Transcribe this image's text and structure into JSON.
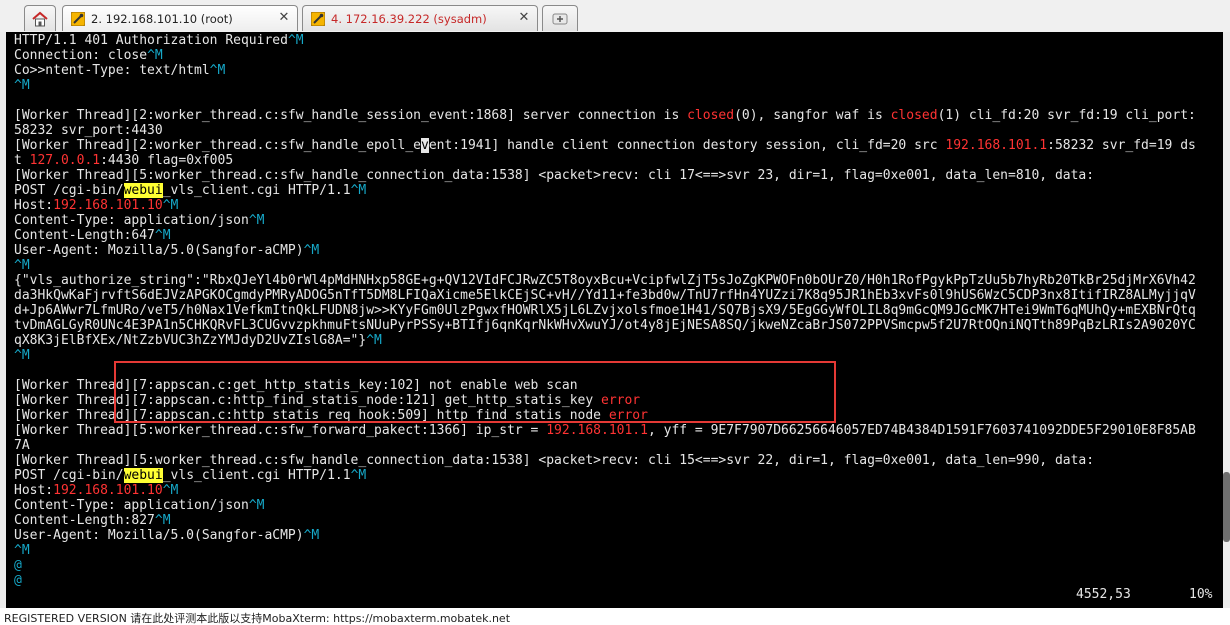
{
  "tabs": [
    {
      "label": "2. 192.168.101.10 (root)",
      "active": true
    },
    {
      "label": "4. 172.16.39.222 (sysadm)",
      "active": false
    }
  ],
  "colors": {
    "background": "#000000",
    "text": "#e6e6e6",
    "control_char": "#16a8c8",
    "highlight_red": "#ff3333",
    "search_hit": "#ffff33",
    "annotation_box": "#e53935"
  },
  "terminal": {
    "lines": [
      [
        {
          "t": "HTTP/1.1 401 Authorization Required"
        },
        {
          "t": "^M",
          "s": "c"
        }
      ],
      [
        {
          "t": "Connection: close"
        },
        {
          "t": "^M",
          "s": "c"
        }
      ],
      [
        {
          "t": "Co>>ntent-Type: text/html"
        },
        {
          "t": "^M",
          "s": "c"
        }
      ],
      [
        {
          "t": "^M",
          "s": "c"
        }
      ],
      [
        {
          "t": ""
        }
      ],
      [
        {
          "t": "[Worker Thread][2:worker_thread.c:sfw_handle_session_event:1868] server connection is "
        },
        {
          "t": "closed",
          "s": "r"
        },
        {
          "t": "(0), sangfor waf is "
        },
        {
          "t": "closed",
          "s": "r"
        },
        {
          "t": "(1) cli_fd:20 svr_fd:19 cli_port:"
        }
      ],
      [
        {
          "t": "58232 svr_port:4430"
        }
      ],
      [
        {
          "t": "[Worker Thread][2:worker_thread.c:sfw_handle_epoll_e"
        },
        {
          "t": "v",
          "s": "cur"
        },
        {
          "t": "ent:1941] handle client connection destory session, cli_fd=20 src "
        },
        {
          "t": "192.168.101.1",
          "s": "r"
        },
        {
          "t": ":58232 svr_fd=19 ds"
        }
      ],
      [
        {
          "t": "t "
        },
        {
          "t": "127.0.0.1",
          "s": "r"
        },
        {
          "t": ":4430 flag=0xf005"
        }
      ],
      [
        {
          "t": "[Worker Thread][5:worker_thread.c:sfw_handle_connection_data:1538] <packet>recv: cli 17<==>svr 23, dir=1, flag=0xe001, data_len=810, data:"
        }
      ],
      [
        {
          "t": "POST /cgi-bin/"
        },
        {
          "t": "webui",
          "s": "hl"
        },
        {
          "t": "_vls_client.cgi HTTP/1.1"
        },
        {
          "t": "^M",
          "s": "c"
        }
      ],
      [
        {
          "t": "Host:"
        },
        {
          "t": "192.168.101.10",
          "s": "r"
        },
        {
          "t": "^M",
          "s": "c"
        }
      ],
      [
        {
          "t": "Content-Type: application/json"
        },
        {
          "t": "^M",
          "s": "c"
        }
      ],
      [
        {
          "t": "Content-Length:647"
        },
        {
          "t": "^M",
          "s": "c"
        }
      ],
      [
        {
          "t": "User-Agent: Mozilla/5.0(Sangfor-aCMP)"
        },
        {
          "t": "^M",
          "s": "c"
        }
      ],
      [
        {
          "t": "^M",
          "s": "c"
        }
      ],
      [
        {
          "t": "{\"vls_authorize_string\":\"RbxQJeYl4b0rWl4pMdHNHxp58GE+g+QV12VIdFCJRwZC5T8oyxBcu+VcipfwlZjT5sJoZgKPWOFn0bOUrZ0/H0h1RofPgykPpTzUu5b7hyRb20TkBr25djMrX6Vh42"
        }
      ],
      [
        {
          "t": "da3HkQwKaFjrvftS6dEJVzAPGKOCgmdyPMRyADOG5nTfT5DM8LFIQaXicme5ElkCEjSC+vH//Yd11+fe3bd0w/TnU7rfHn4YUZzi7K8q95JR1hEb3xvFs0l9hUS6WzC5CDP3nx8ItifIRZ8ALMyjjqV"
        }
      ],
      [
        {
          "t": "d+Jp6AWwr7LfmURo/veT5/h0Nax1VefkmItnQkLFUDN8jw>>KYyFGm0UlzPgwxfHOWRlX5jL6LZvjxolsfmoe1H41/SQ7BjsX9/5EgGGyWfOLIL8q9mGcQM9JGcMK7HTei9WmT6qMUhQy+mEXBNrQtq"
        }
      ],
      [
        {
          "t": "tvDmAGLGyR0UNc4E3PA1n5CHKQRvFL3CUGvvzpkhmuFtsNUuPyrPSSy+BTIfj6qnKqrNkWHvXwuYJ/ot4y8jEjNESA8SQ/jkweNZcaBrJS072PPVSmcpw5f2U7RtOQniNQTth89PqBzLRIs2A9020YC"
        }
      ],
      [
        {
          "t": "qX8K3jElBfXEx/NtZzbVUC3hZzYMJdyD2UvZIslG8A=\"}"
        },
        {
          "t": "^M",
          "s": "c"
        }
      ],
      [
        {
          "t": "^M",
          "s": "c"
        }
      ],
      [
        {
          "t": ""
        }
      ],
      [
        {
          "t": "[Worker Thread][7:appscan.c:get_http_statis_key:102] not enable web scan"
        }
      ],
      [
        {
          "t": "[Worker Thread][7:appscan.c:http_find_statis_node:121] get_http_statis_key "
        },
        {
          "t": "error",
          "s": "r"
        }
      ],
      [
        {
          "t": "[Worker Thread][7:appscan.c:http_statis_req_hook:509] http find statis node "
        },
        {
          "t": "error",
          "s": "r"
        }
      ],
      [
        {
          "t": "[Worker Thread][5:worker_thread.c:sfw_forward_pakect:1366] ip_str = "
        },
        {
          "t": "192.168.101.1",
          "s": "r"
        },
        {
          "t": ", yff = 9E7F7907D66256646057ED74B4384D1591F7603741092DDE5F29010E8F85AB"
        }
      ],
      [
        {
          "t": "7A"
        }
      ],
      [
        {
          "t": "[Worker Thread][5:worker_thread.c:sfw_handle_connection_data:1538] <packet>recv: cli 15<==>svr 22, dir=1, flag=0xe001, data_len=990, data:"
        }
      ],
      [
        {
          "t": "POST /cgi-bin/"
        },
        {
          "t": "webui",
          "s": "hl"
        },
        {
          "t": "_vls_client.cgi HTTP/1.1"
        },
        {
          "t": "^M",
          "s": "c"
        }
      ],
      [
        {
          "t": "Host:"
        },
        {
          "t": "192.168.101.10",
          "s": "r"
        },
        {
          "t": "^M",
          "s": "c"
        }
      ],
      [
        {
          "t": "Content-Type: application/json"
        },
        {
          "t": "^M",
          "s": "c"
        }
      ],
      [
        {
          "t": "Content-Length:827"
        },
        {
          "t": "^M",
          "s": "c"
        }
      ],
      [
        {
          "t": "User-Agent: Mozilla/5.0(Sangfor-aCMP)"
        },
        {
          "t": "^M",
          "s": "c"
        }
      ],
      [
        {
          "t": "^M",
          "s": "c"
        }
      ],
      [
        {
          "t": "@",
          "s": "c"
        }
      ],
      [
        {
          "t": "@",
          "s": "c"
        }
      ]
    ],
    "status_position": "4552,53",
    "status_percent": "10%"
  },
  "bottom_bar_text": "REGISTERED VERSION   请在此处评测本此版以支持MobaXterm: https://mobaxterm.mobatek.net"
}
